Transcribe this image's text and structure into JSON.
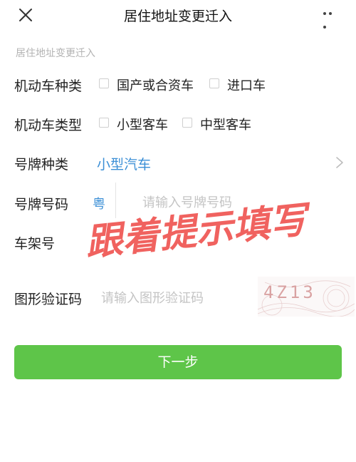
{
  "header": {
    "title": "居住地址变更迁入",
    "close_icon": "close-icon",
    "more_icon": "more-icon"
  },
  "subtitle": "居住地址变更迁入",
  "vehicle_category": {
    "label": "机动车种类",
    "options": [
      "国产或合资车",
      "进口车"
    ]
  },
  "vehicle_type": {
    "label": "机动车类型",
    "options": [
      "小型客车",
      "中型客车"
    ]
  },
  "plate_type": {
    "label": "号牌种类",
    "value": "小型汽车"
  },
  "plate_number": {
    "label": "号牌号码",
    "province": "粤",
    "placeholder": "请输入号牌号码"
  },
  "vin": {
    "label": "车架号",
    "value": ""
  },
  "captcha": {
    "label": "图形验证码",
    "placeholder": "请输入图形验证码",
    "image_text": "4Z13"
  },
  "next_button": "下一步",
  "overlay": {
    "text": "跟着提示填写"
  },
  "colors": {
    "accent_blue": "#3b8fd6",
    "primary_green": "#5ec549",
    "overlay_red": "#f0625f"
  }
}
